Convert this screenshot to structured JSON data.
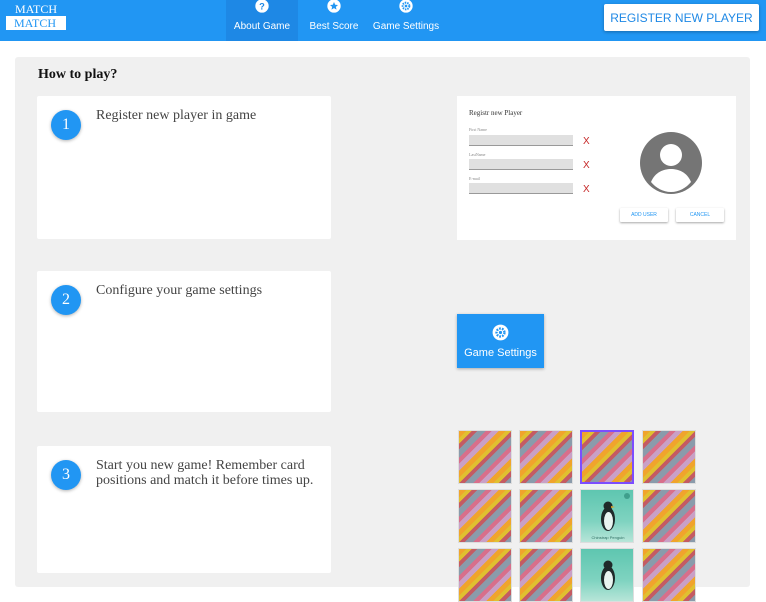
{
  "header": {
    "logo_top": "MATCH",
    "logo_bottom": "MATCH",
    "nav": [
      {
        "label": "About Game",
        "icon": "help-circle-icon",
        "active": true
      },
      {
        "label": "Best Score",
        "icon": "star-circle-icon",
        "active": false
      },
      {
        "label": "Game Settings",
        "icon": "gear-icon",
        "active": false
      }
    ],
    "register_button": "REGISTER NEW PLAYER"
  },
  "how_to_play": {
    "title": "How to play?",
    "steps": [
      {
        "number": "1",
        "text": "Register new player in game"
      },
      {
        "number": "2",
        "text": "Configure your game settings"
      },
      {
        "number": "3",
        "text": "Start you new game! Remember card positions and match it before times up."
      }
    ]
  },
  "register_preview": {
    "title": "Registr new Player",
    "fields": [
      {
        "label": "First Name",
        "clear": "X"
      },
      {
        "label": "LastName",
        "clear": "X"
      },
      {
        "label": "E-mail",
        "clear": "X"
      }
    ],
    "avatar_icon": "account-circle-icon",
    "add_button": "ADD USER",
    "cancel_button": "CANCEL"
  },
  "game_settings_preview": {
    "label": "Game Settings",
    "icon": "gear-icon"
  },
  "cards_preview": {
    "cards": [
      {
        "type": "back"
      },
      {
        "type": "back"
      },
      {
        "type": "back",
        "selected": true
      },
      {
        "type": "back"
      },
      {
        "type": "back"
      },
      {
        "type": "back"
      },
      {
        "type": "face",
        "image": "penguin",
        "caption": "Chinstrap Penguin"
      },
      {
        "type": "back"
      },
      {
        "type": "back"
      },
      {
        "type": "back"
      },
      {
        "type": "face",
        "image": "penguin"
      },
      {
        "type": "back"
      }
    ]
  },
  "colors": {
    "primary": "#2196f3",
    "primary_dark": "#1e88e5",
    "panel": "#f0f0f0",
    "selected_card": "#7c4dff"
  }
}
